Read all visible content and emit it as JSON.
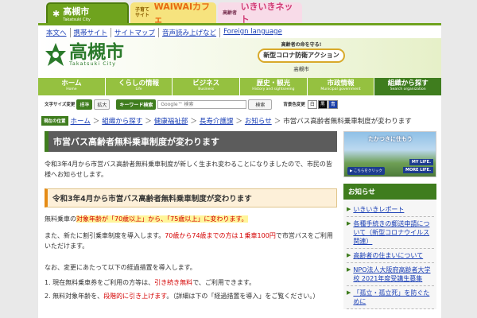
{
  "portal_tabs": [
    {
      "label": "高槻市",
      "sub": "Takatsuki City"
    },
    {
      "label": "WAIWAIカフェ",
      "sub": "子育てサイト"
    },
    {
      "label": "いきいきネット",
      "sub": "高齢者"
    }
  ],
  "util_links": [
    "本文へ",
    "携帯サイト",
    "サイトマップ",
    "音声読み上げなど",
    "Foreign language"
  ],
  "logo": {
    "title": "高槻市",
    "subtitle": "Takatsuki City"
  },
  "campaign": {
    "top": "高齢者の命を守る!",
    "main": "新型コロナ防衛アクション",
    "bottom": "高槻市"
  },
  "nav": [
    {
      "label": "ホーム",
      "en": "Home"
    },
    {
      "label": "くらしの情報",
      "en": "Life"
    },
    {
      "label": "ビジネス",
      "en": "Business"
    },
    {
      "label": "歴史・観光",
      "en": "History and sightseeing"
    },
    {
      "label": "市政情報",
      "en": "Municipal government"
    },
    {
      "label": "組織から探す",
      "en": "Search organization"
    }
  ],
  "tools": {
    "font_size_label": "文字サイズ変更",
    "standard": "標準",
    "enlarge": "拡大",
    "keyword_label": "キーワード検索",
    "search_placeholder": "Google™ 検索",
    "search_button": "検索",
    "bg_color_label": "背景色変更",
    "bg_white": "白",
    "bg_black": "黒",
    "bg_blue": "青"
  },
  "breadcrumb": {
    "badge": "現在の位置",
    "items": [
      "ホーム",
      "組織から探す",
      "健康福祉部",
      "長寿介護課",
      "お知らせ"
    ],
    "current": "市営バス高齢者無料乗車制度が変わります"
  },
  "main": {
    "title": "市営バス高齢者無料乗車制度が変わります",
    "intro": "令和3年4月から市営バス高齢者無料乗車制度が新しく生まれ変わることになりましたので、市民の皆様へお知らせします。",
    "sub_heading": "令和3年4月から市営バス高齢者無料乗車制度が変わります",
    "p1_a": "無料乗車の",
    "p1_b": "対象年齢が「70歳以上」から、「75歳以上」に変わります。",
    "p2_a": "また、新たに割引乗車制度を導入します。",
    "p2_b": "70歳から74歳までの方は１乗車100円",
    "p2_c": "で市営バスをご利用いただけます。",
    "p3": "なお、変更にあたって以下の経過措置を導入します。",
    "li1_a": "1. 現在無料乗車券をご利用の方等は、",
    "li1_b": "引き続き無料",
    "li1_c": "で、ご利用できます。",
    "li2_a": "2. 無料対象年齢を、",
    "li2_b": "段階的に引き上げます",
    "li2_c": "。（詳細は下の「経過措置を導入」をご覧ください。）"
  },
  "side": {
    "banner_title": "たかつきに住もう",
    "banner_click": "こちらをクリック",
    "banner_my": "MY LIFE.",
    "banner_more": "MORE LIFE.",
    "news_heading": "お知らせ",
    "news": [
      "いきいきレポート",
      "各種手続きの郵送申請について（新型コロナウイルス関連）",
      "高齢者の住まいについて",
      "NPO法人大阪府高齢者大学校 2021年度受講生募集",
      "「孤立・孤立死」を防ぐために"
    ]
  }
}
